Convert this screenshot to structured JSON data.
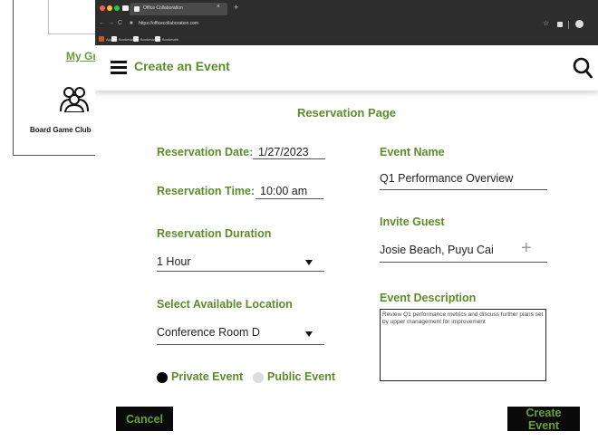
{
  "background": {
    "my_groups_label": "My Gr",
    "group_label": "Board Game Club"
  },
  "browser": {
    "tab_title": "Office Collaboration",
    "tab_close": "×",
    "new_tab": "+",
    "url": "https://officecollaboration.com",
    "bookmarks": [
      "Apps",
      "Bookmark",
      "Bookmark",
      "Bookmark"
    ]
  },
  "header": {
    "title": "Create an Event",
    "menu_icon": "hamburger-menu-icon",
    "search_icon": "search-icon"
  },
  "form": {
    "section_title": "Reservation Page",
    "reservation_date": {
      "label": "Reservation Date:",
      "value": "1/27/2023"
    },
    "reservation_time": {
      "label": "Reservation Time:",
      "value": "10:00 am"
    },
    "reservation_duration": {
      "label": "Reservation Duration",
      "value": "1 Hour"
    },
    "location": {
      "label": "Select Available Location",
      "value": "Conference Room D"
    },
    "event_name": {
      "label": "Event Name",
      "value": "Q1 Performance Overview"
    },
    "invite_guest": {
      "label": "Invite Guest",
      "value": "Josie Beach, Puyu Cai",
      "add_icon": "+"
    },
    "event_description": {
      "label": "Event Description",
      "value": "Review Q1 performance metrics and discuss further plans set by upper management for improvement"
    },
    "visibility": {
      "private_label": "Private Event",
      "public_label": "Public Event",
      "selected": "Private Event"
    }
  },
  "actions": {
    "cancel_label": "Cancel",
    "create_label": "Create Event"
  },
  "colors": {
    "accent_green": "#5b8c2a",
    "button_bg": "#0a0a0a",
    "button_text": "#6aa335",
    "chrome_bg": "#2d2d2d"
  }
}
